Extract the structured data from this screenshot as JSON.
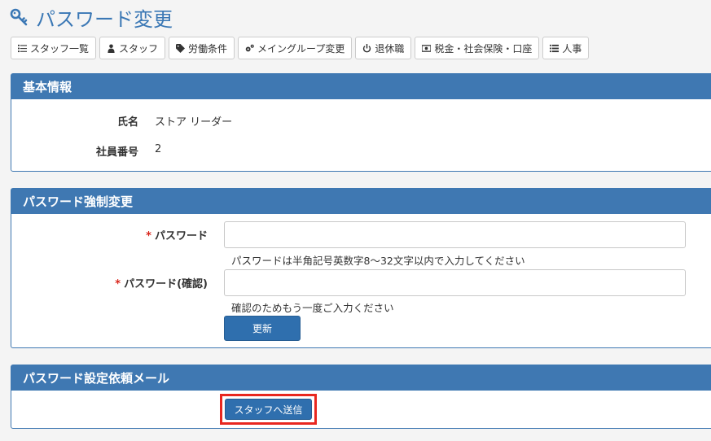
{
  "page": {
    "title": "パスワード変更"
  },
  "toolbar": [
    {
      "label": "スタッフ一覧",
      "icon": "list-numbered-icon"
    },
    {
      "label": "スタッフ",
      "icon": "user-icon"
    },
    {
      "label": "労働条件",
      "icon": "tag-icon"
    },
    {
      "label": "メイングループ変更",
      "icon": "gears-icon"
    },
    {
      "label": "退休職",
      "icon": "power-icon"
    },
    {
      "label": "税金・社会保険・口座",
      "icon": "money-icon"
    },
    {
      "label": "人事",
      "icon": "list-icon"
    }
  ],
  "basic_info": {
    "heading": "基本情報",
    "name_label": "氏名",
    "name_value": "ストア リーダー",
    "id_label": "社員番号",
    "id_value": "2"
  },
  "force_change": {
    "heading": "パスワード強制変更",
    "required_mark": "*",
    "password_label": "パスワード",
    "password_value": "",
    "password_help": "パスワードは半角記号英数字8〜32文字以内で入力してください",
    "confirm_label": "パスワード(確認)",
    "confirm_value": "",
    "confirm_help": "確認のためもう一度ご入力ください",
    "submit_label": "更新"
  },
  "request_mail": {
    "heading": "パスワード設定依頼メール",
    "send_label": "スタッフへ送信"
  },
  "colors": {
    "accent": "#3f78b2",
    "highlight": "#e8271f",
    "required": "#d9261c"
  }
}
